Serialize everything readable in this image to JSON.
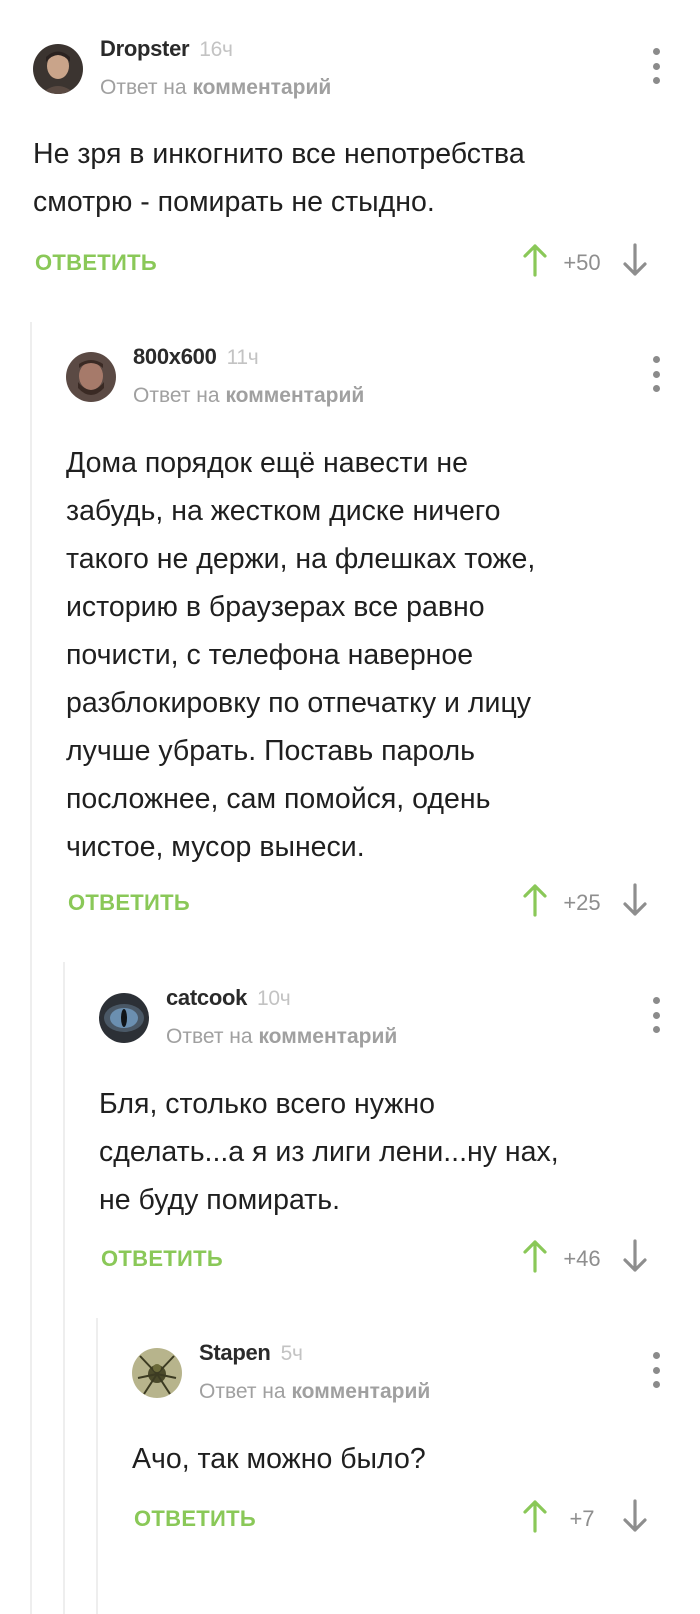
{
  "comments": [
    {
      "user": "Dropster",
      "time": "16ч",
      "reply_prefix": "Ответ на",
      "reply_link": "комментарий",
      "lines": [
        "Не зря в инкогнито все непотребства",
        "смотрю - помирать не стыдно."
      ],
      "reply_label": "ОТВЕТИТЬ",
      "rating": "+50"
    },
    {
      "user": "800x600",
      "time": "11ч",
      "reply_prefix": "Ответ на",
      "reply_link": "комментарий",
      "lines": [
        "Дома порядок ещё навести не",
        "забудь, на жестком диске ничего",
        "такого не держи, на флешках тоже,",
        "историю в браузерах все равно",
        "почисти, с телефона наверное",
        "разблокировку по отпечатку и лицу",
        "лучше убрать. Поставь пароль",
        "посложнее, сам помойся, одень",
        "чистое, мусор вынеси."
      ],
      "reply_label": "ОТВЕТИТЬ",
      "rating": "+25"
    },
    {
      "user": "catcook",
      "time": "10ч",
      "reply_prefix": "Ответ на",
      "reply_link": "комментарий",
      "lines": [
        "Бля, столько всего нужно",
        "сделать...а я из лиги лени...ну нах,",
        "не буду помирать."
      ],
      "reply_label": "ОТВЕТИТЬ",
      "rating": "+46"
    },
    {
      "user": "Stapen",
      "time": "5ч",
      "reply_prefix": "Ответ на",
      "reply_link": "комментарий",
      "lines": [
        "Ачо, так можно было?"
      ],
      "reply_label": "ОТВЕТИТЬ",
      "rating": "+7"
    }
  ],
  "colors": {
    "reply_green": "#8ac858",
    "upvote_green": "#8ac858",
    "muted_gray": "#a0a0a0",
    "thread_line": "#eeeeee"
  },
  "icons": {
    "menu": "more-vertical-icon",
    "upvote": "arrow-up-icon",
    "downvote": "arrow-down-icon"
  }
}
